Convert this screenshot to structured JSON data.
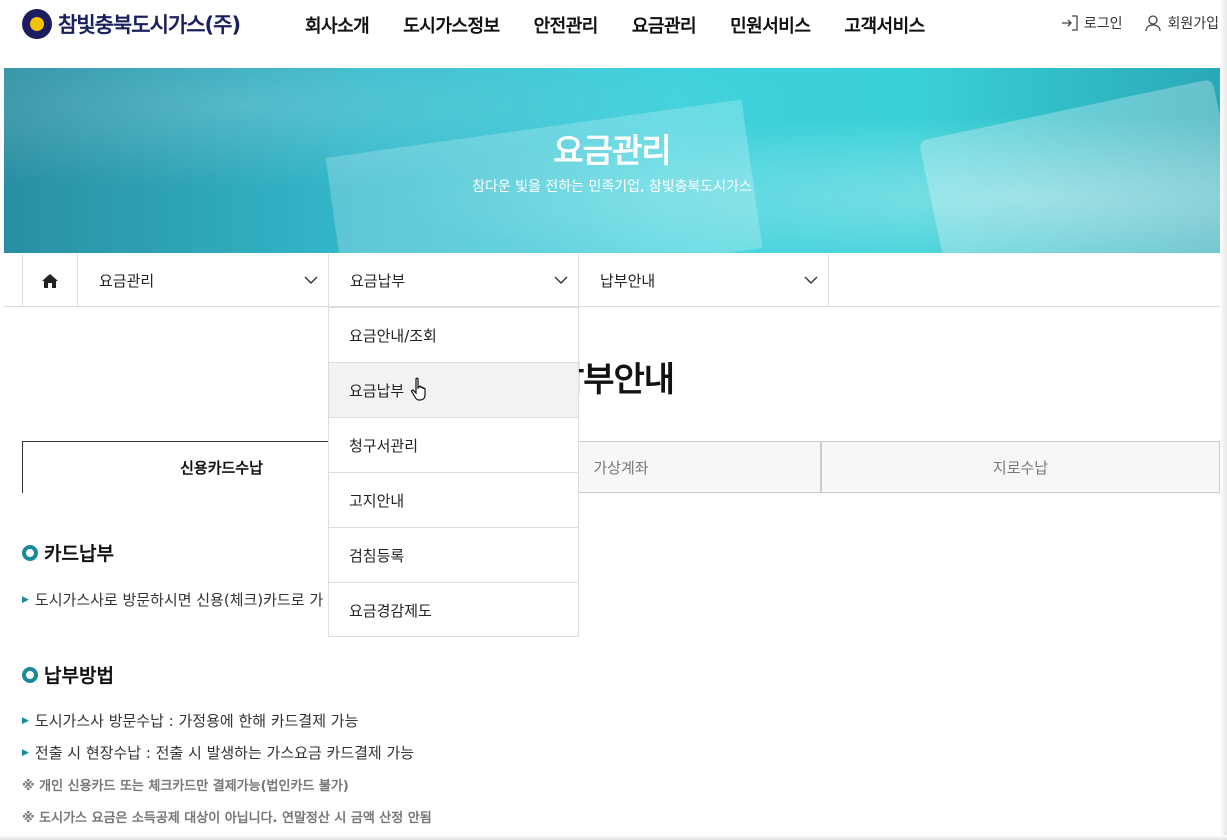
{
  "header": {
    "logo_text": "참빛충북도시가스(주)",
    "nav": [
      "회사소개",
      "도시가스정보",
      "안전관리",
      "요금관리",
      "민원서비스",
      "고객서비스"
    ],
    "login_label": "로그인",
    "join_label": "회원가입"
  },
  "banner": {
    "title": "요금관리",
    "subtitle": "참다운 빛을 전하는 민족기업, 참빛충북도시가스"
  },
  "location": {
    "home_icon": "home-icon",
    "depth1": "요금관리",
    "depth2": "요금납부",
    "depth3": "납부안내"
  },
  "dropdown": {
    "items": [
      "요금안내/조회",
      "요금납부",
      "청구서관리",
      "고지안내",
      "검침등록",
      "요금경감제도"
    ],
    "hovered_index": 1
  },
  "page_title": "납부안내",
  "tabs": [
    "신용카드수납",
    "가상계좌",
    "지로수납"
  ],
  "content": {
    "section1_title": "카드납부",
    "section1_text": "도시가스사로 방문하시면 신용(체크)카드로 가",
    "section2_title": "납부방법",
    "section2_items": [
      "도시가스사 방문수납 : 가정용에 한해 카드결제 가능",
      "전출 시 현장수납 : 전출 시 발생하는 가스요금 카드결제 가능"
    ],
    "notes": [
      "※ 개인 신용카드 또는 체크카드만 결제가능(법인카드 불가)",
      "※ 도시가스 요금은 소득공제 대상이 아닙니다. 연말정산 시 금액 산정 안됨"
    ]
  },
  "colors": {
    "accent": "#1a8a9a",
    "brand": "#1a1f5e"
  }
}
